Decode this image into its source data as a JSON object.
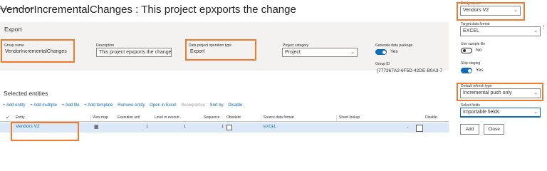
{
  "page": {
    "title": "VendorIncrementalChanges : This project epxports the change"
  },
  "export_section": {
    "title": "Export",
    "group_name": {
      "label": "Group name",
      "value": "VendorIncrementalChanges"
    },
    "description": {
      "label": "Description",
      "value": "This project epxports the changes"
    },
    "operation_type": {
      "label": "Data project operation type",
      "value": "Export"
    },
    "project_category": {
      "label": "Project category",
      "value": "Project"
    },
    "generate_package": {
      "label": "Generate data package",
      "value": "Yes"
    },
    "group_id": {
      "label": "Group ID",
      "value": "{777367A2-6F5D-42DE-B0A3-7"
    }
  },
  "selected_entities": {
    "title": "Selected entities",
    "toolbar": {
      "add_entity": "+ Add entity",
      "add_multiple": "+ Add multiple",
      "add_file": "+ Add file",
      "add_template": "+ Add template",
      "remove_entity": "Remove entity",
      "open_excel": "Open in Excel",
      "resequence": "Resequence",
      "sort_by": "Sort by",
      "disable": "Disable"
    },
    "columns": {
      "entity": "Entity",
      "view_map": "View map",
      "execution_unit": "Execution unit",
      "level": "Level in executi...",
      "sequence": "Sequence",
      "obsolete": "Obsolete",
      "source_format": "Source data format",
      "sheet_lookup": "Sheet lookup",
      "disable": "Disable"
    },
    "rows": [
      {
        "entity": "Vendors V2",
        "execution_unit": "1",
        "level": "1",
        "sequence": "1",
        "source_format": "EXCEL"
      }
    ]
  },
  "panel": {
    "entity_name": {
      "label": "Entity name",
      "value": "Vendors V2"
    },
    "target_format": {
      "label": "Target data format",
      "value": "EXCEL"
    },
    "use_sample": {
      "label": "Use sample file",
      "value": "No"
    },
    "skip_staging": {
      "label": "Skip staging",
      "value": "Yes"
    },
    "default_refresh": {
      "label": "Default refresh type",
      "value": "Incremental push only"
    },
    "select_fields": {
      "label": "Select fields",
      "value": "Importable fields"
    },
    "add_button": "Add",
    "close_button": "Close"
  },
  "colors": {
    "accent": "#0f6cbd",
    "highlight": "#f07b2c",
    "selected_row": "#dbe8f7"
  }
}
